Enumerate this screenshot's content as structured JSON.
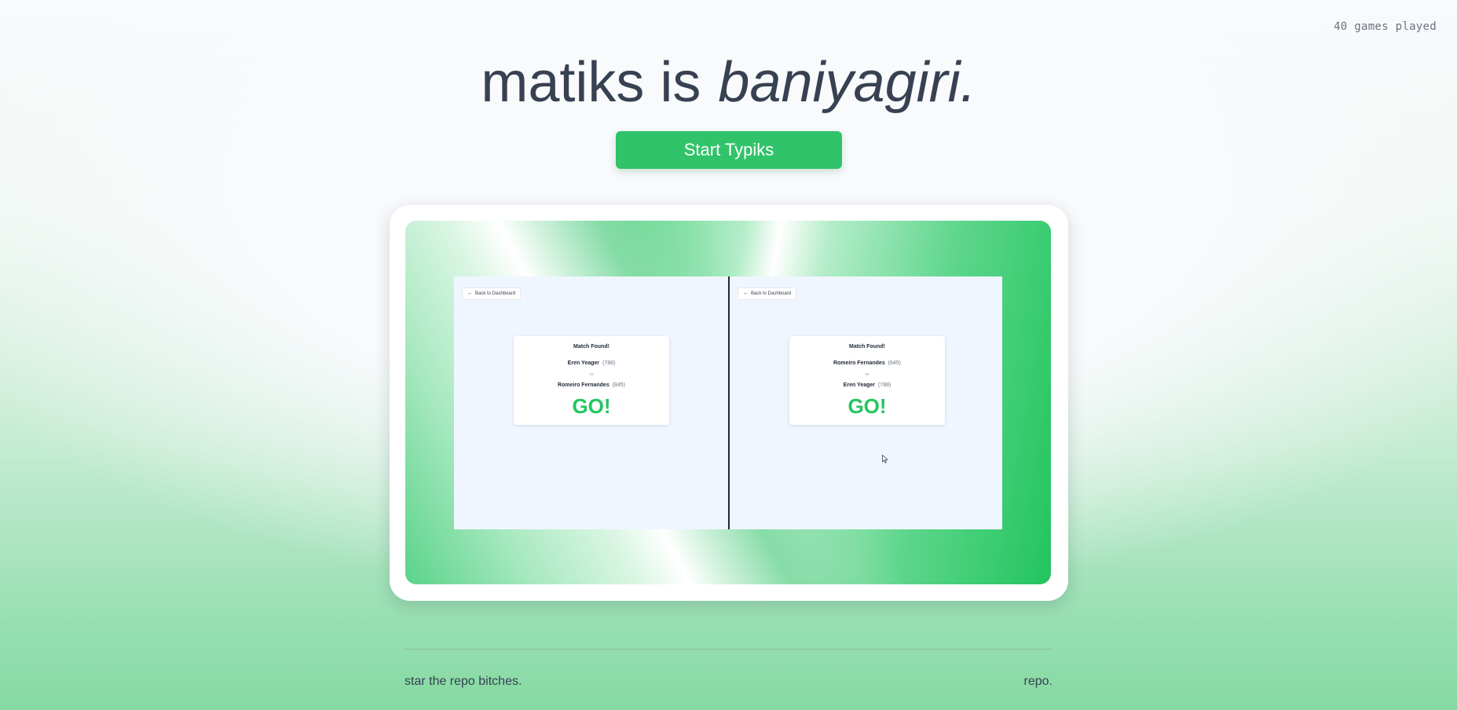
{
  "stats": {
    "games_played": "40 games played"
  },
  "hero": {
    "title_prefix": "matiks is",
    "title_emphasis": "baniyagiri.",
    "cta_label": "Start Typiks"
  },
  "demo": {
    "left_pane": {
      "back_label": "Back to Dashboard",
      "match_title": "Match Found!",
      "player1": {
        "name": "Eren Yeager",
        "rating": "(788)"
      },
      "vs": "vs",
      "player2": {
        "name": "Romeiro Fernandes",
        "rating": "(845)"
      },
      "go": "GO!"
    },
    "right_pane": {
      "back_label": "Back to Dashboard",
      "match_title": "Match Found!",
      "player1": {
        "name": "Romeiro Fernandes",
        "rating": "(845)"
      },
      "vs": "vs",
      "player2": {
        "name": "Eren Yeager",
        "rating": "(788)"
      },
      "go": "GO!"
    },
    "colors": {
      "accent": "#22c55e",
      "screen_bg": "#eff6ff"
    }
  },
  "footer": {
    "left_text": "star the repo bitches.",
    "right_link": "repo."
  },
  "icons": [
    "arrow-left-icon",
    "mouse-cursor-icon"
  ]
}
